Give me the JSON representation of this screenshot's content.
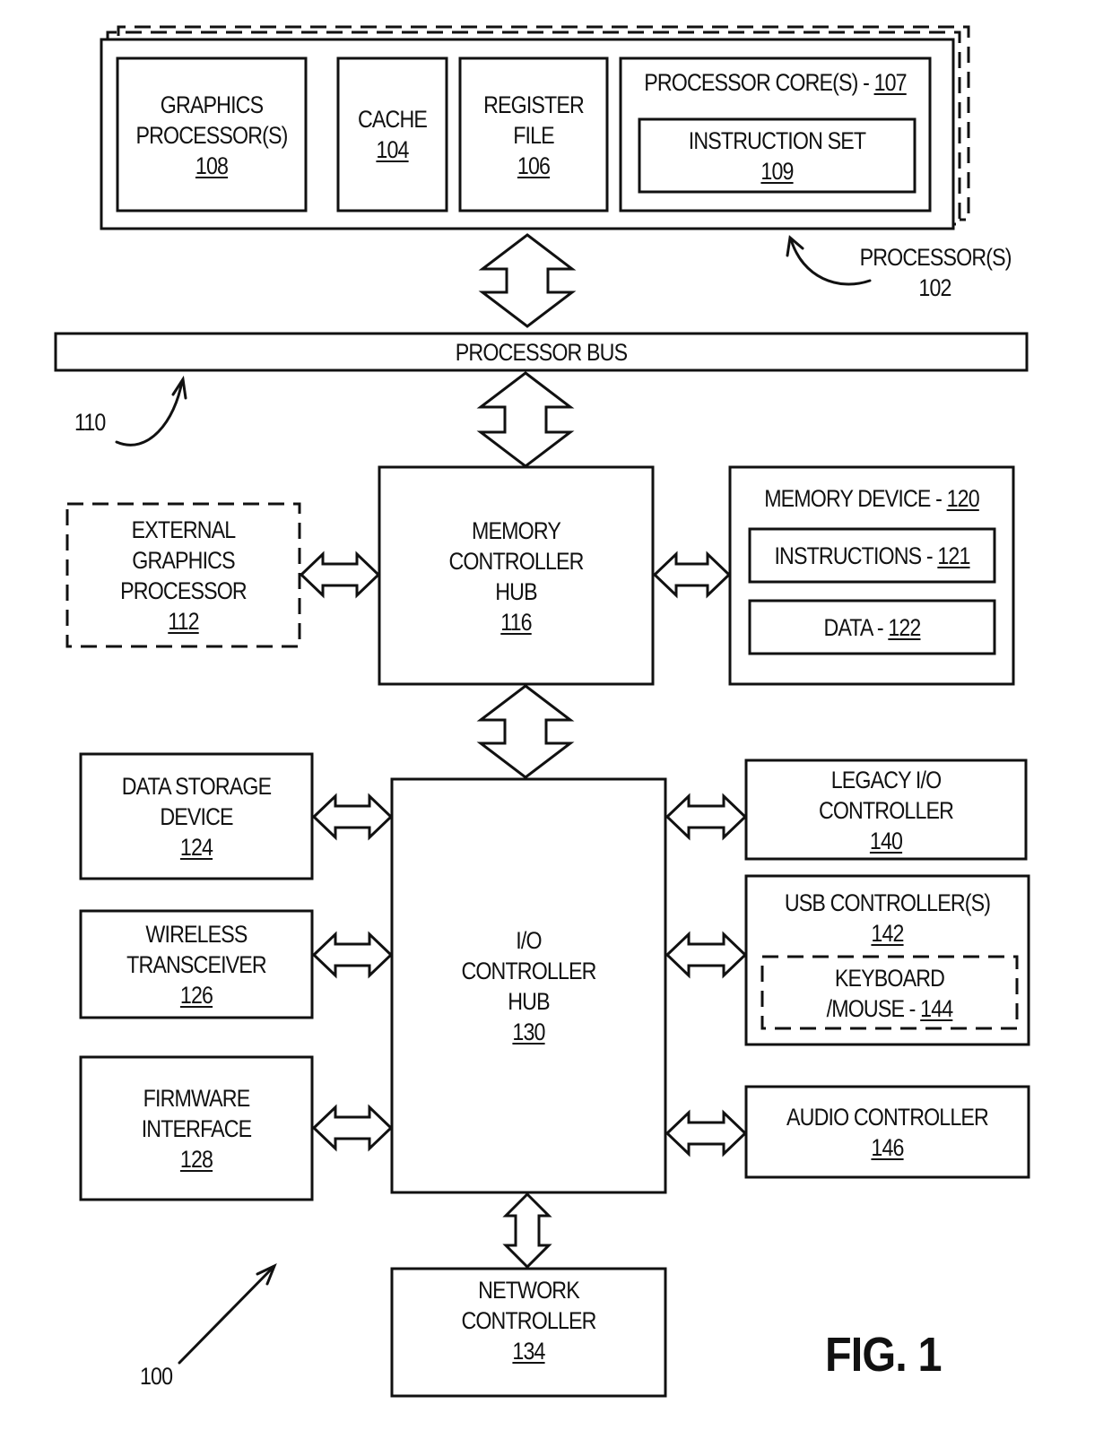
{
  "figure": {
    "title": "FIG. 1",
    "system_ref": "100",
    "processor_group": {
      "label": "PROCESSOR(S)",
      "ref": "102"
    },
    "bus_ref": "110"
  },
  "processor": {
    "graphics": {
      "lines": [
        "GRAPHICS",
        "PROCESSOR(S)"
      ],
      "ref": "108"
    },
    "cache": {
      "lines": [
        "CACHE"
      ],
      "ref": "104"
    },
    "register_file": {
      "lines": [
        "REGISTER",
        "FILE"
      ],
      "ref": "106"
    },
    "core": {
      "label": "PROCESSOR CORE(S) - ",
      "ref": "107"
    },
    "instruction_set": {
      "lines": [
        "INSTRUCTION SET"
      ],
      "ref": "109"
    }
  },
  "bus": {
    "label": "PROCESSOR BUS"
  },
  "external_graphics": {
    "lines": [
      "EXTERNAL",
      "GRAPHICS",
      "PROCESSOR"
    ],
    "ref": "112"
  },
  "memory_controller_hub": {
    "lines": [
      "MEMORY",
      "CONTROLLER",
      "HUB"
    ],
    "ref": "116"
  },
  "memory_device": {
    "label": "MEMORY DEVICE - ",
    "ref": "120",
    "instructions": {
      "label": "INSTRUCTIONS - ",
      "ref": "121"
    },
    "data": {
      "label": "DATA - ",
      "ref": "122"
    }
  },
  "io_controller_hub": {
    "lines": [
      "I/O",
      "CONTROLLER",
      "HUB"
    ],
    "ref": "130"
  },
  "data_storage": {
    "lines": [
      "DATA STORAGE",
      "DEVICE"
    ],
    "ref": "124"
  },
  "wireless": {
    "lines": [
      "WIRELESS",
      "TRANSCEIVER"
    ],
    "ref": "126"
  },
  "firmware": {
    "lines": [
      "FIRMWARE",
      "INTERFACE"
    ],
    "ref": "128"
  },
  "legacy_io": {
    "lines": [
      "LEGACY I/O",
      "CONTROLLER"
    ],
    "ref": "140"
  },
  "usb": {
    "lines": [
      "USB CONTROLLER(S)"
    ],
    "ref": "142",
    "keyboard": {
      "line1": "KEYBOARD",
      "line2": "/MOUSE - ",
      "ref": "144"
    }
  },
  "audio": {
    "lines": [
      "AUDIO CONTROLLER"
    ],
    "ref": "146"
  },
  "network": {
    "lines": [
      "NETWORK",
      "CONTROLLER"
    ],
    "ref": "134"
  }
}
